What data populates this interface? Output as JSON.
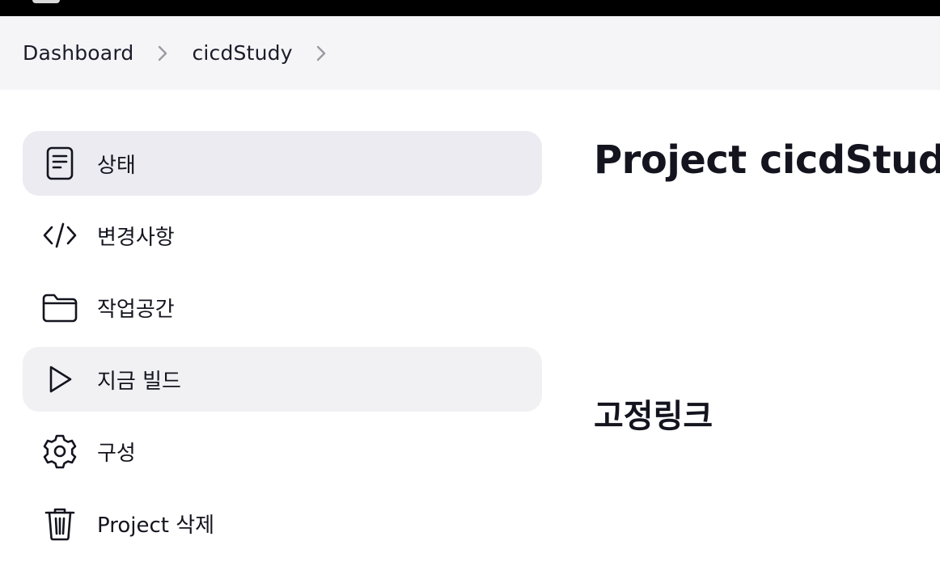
{
  "breadcrumb": {
    "items": [
      {
        "label": "Dashboard"
      },
      {
        "label": "cicdStudy"
      }
    ]
  },
  "sidebar": {
    "items": [
      {
        "label": "상태",
        "icon": "document-icon",
        "state": "active"
      },
      {
        "label": "변경사항",
        "icon": "code-icon"
      },
      {
        "label": "작업공간",
        "icon": "folder-icon"
      },
      {
        "label": "지금 빌드",
        "icon": "play-icon",
        "state": "hovered"
      },
      {
        "label": "구성",
        "icon": "gear-icon"
      },
      {
        "label": "Project 삭제",
        "icon": "trash-icon"
      }
    ]
  },
  "main": {
    "title": "Project cicdStudy",
    "permalinks_heading": "고정링크"
  },
  "colors": {
    "topbar": "#000000",
    "breadcrumb_bg": "#f5f5f7",
    "active_item_bg": "#ebebf1",
    "text": "#14141f"
  }
}
